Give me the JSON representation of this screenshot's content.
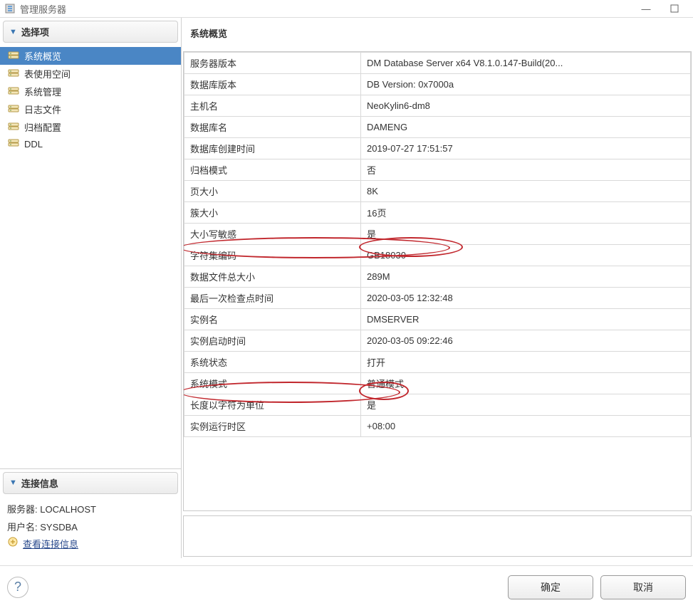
{
  "window": {
    "title": "管理服务器"
  },
  "sidebar": {
    "select_header": "选择项",
    "items": [
      {
        "label": "系统概览",
        "selected": true
      },
      {
        "label": "表使用空间",
        "selected": false
      },
      {
        "label": "系统管理",
        "selected": false
      },
      {
        "label": "日志文件",
        "selected": false
      },
      {
        "label": "归档配置",
        "selected": false
      },
      {
        "label": "DDL",
        "selected": false
      }
    ],
    "conn_header": "连接信息",
    "conn": {
      "server_label": "服务器: ",
      "server_value": "LOCALHOST",
      "user_label": "用户名: ",
      "user_value": "SYSDBA",
      "link": "查看连接信息"
    }
  },
  "main": {
    "title": "系统概览",
    "rows": [
      {
        "k": "服务器版本",
        "v": "DM Database Server x64 V8.1.0.147-Build(20..."
      },
      {
        "k": "数据库版本",
        "v": "DB Version: 0x7000a"
      },
      {
        "k": "主机名",
        "v": "NeoKylin6-dm8"
      },
      {
        "k": "数据库名",
        "v": "DAMENG"
      },
      {
        "k": "数据库创建时间",
        "v": "2019-07-27 17:51:57"
      },
      {
        "k": "归档模式",
        "v": "否"
      },
      {
        "k": "页大小",
        "v": "8K"
      },
      {
        "k": "簇大小",
        "v": "16页"
      },
      {
        "k": "大小写敏感",
        "v": "是"
      },
      {
        "k": "字符集编码",
        "v": "GB18030"
      },
      {
        "k": "数据文件总大小",
        "v": "289M"
      },
      {
        "k": "最后一次检查点时间",
        "v": "2020-03-05 12:32:48"
      },
      {
        "k": "实例名",
        "v": "DMSERVER"
      },
      {
        "k": "实例启动时间",
        "v": "2020-03-05 09:22:46"
      },
      {
        "k": "系统状态",
        "v": "打开"
      },
      {
        "k": "系统模式",
        "v": "普通模式"
      },
      {
        "k": "长度以字符为单位",
        "v": "是"
      },
      {
        "k": "实例运行时区",
        "v": "+08:00"
      }
    ]
  },
  "footer": {
    "ok": "确定",
    "cancel": "取消"
  }
}
